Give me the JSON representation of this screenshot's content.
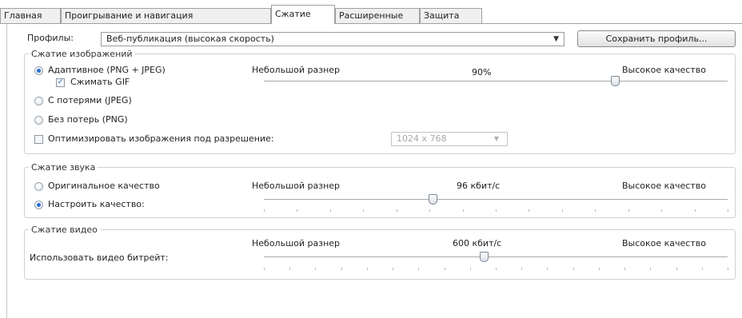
{
  "tabs": [
    {
      "label": "Главная",
      "active": false
    },
    {
      "label": "Проигрывание и навигация",
      "active": false
    },
    {
      "label": "Сжатие",
      "active": true
    },
    {
      "label": "Расширенные",
      "active": false
    },
    {
      "label": "Защита",
      "active": false
    }
  ],
  "profile": {
    "label": "Профилы:",
    "value": "Веб-публикация (высокая скорость)",
    "save_button": "Сохранить профиль..."
  },
  "image_compression": {
    "title": "Сжатие изображений",
    "adaptive_label": "Адаптивное (PNG + JPEG)",
    "adaptive_selected": true,
    "compress_gif_label": "Сжимать GIF",
    "compress_gif_checked": true,
    "small_size_label": "Небольшой разнер",
    "value_label": "90%",
    "high_quality_label": "Высокое качество",
    "slider_level": 0.9,
    "lossy_label": "С потерями (JPEG)",
    "lossless_label": "Без потерь (PNG)",
    "optimize_label": "Оптимизировать изображения под разрешение:",
    "optimize_checked": false,
    "resolution_value": "1024 x 768"
  },
  "audio_compression": {
    "title": "Сжатие звука",
    "original_label": "Оригинальное качество",
    "original_selected": false,
    "custom_label": "Настроить качество:",
    "custom_selected": true,
    "small_size_label": "Небольшой разнер",
    "value_label": "96 кбит/с",
    "high_quality_label": "Высокое качество"
  },
  "video_compression": {
    "title": "Сжатие видео",
    "bitrate_label": "Использовать видео битрейт:",
    "small_size_label": "Небольшой разнер",
    "value_label": "600 кбит/с",
    "high_quality_label": "Высокое качество"
  },
  "colors": {
    "accent": "#2b6fd0",
    "border": "#d0d0d0"
  }
}
